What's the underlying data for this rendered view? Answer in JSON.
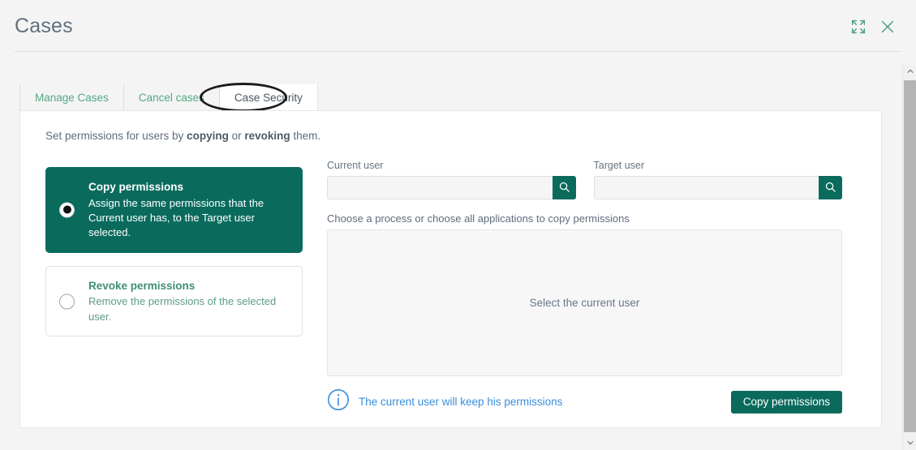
{
  "header": {
    "title": "Cases",
    "expand_icon": "expand-icon",
    "close_icon": "close-icon"
  },
  "tabs": [
    {
      "label": "Manage Cases",
      "active": false
    },
    {
      "label": "Cancel cases",
      "active": false
    },
    {
      "label": "Case Security",
      "active": true
    }
  ],
  "panel": {
    "intro_prefix": "Set permissions for users by ",
    "intro_bold1": "copying",
    "intro_middle": " or ",
    "intro_bold2": "revoking",
    "intro_suffix": " them."
  },
  "options": [
    {
      "title": "Copy permissions",
      "description": "Assign the same permissions that the Current user has, to the Target user selected.",
      "selected": true
    },
    {
      "title": "Revoke permissions",
      "description": "Remove the permissions of the selected user.",
      "selected": false
    }
  ],
  "fields": {
    "current_user": {
      "label": "Current user",
      "value": "",
      "placeholder": "",
      "search_icon": "search-icon"
    },
    "target_user": {
      "label": "Target user",
      "value": "",
      "placeholder": "",
      "search_icon": "search-icon"
    }
  },
  "process": {
    "label": "Choose a process or choose all applications to copy permissions",
    "empty_text": "Select the current user"
  },
  "footer": {
    "info_icon": "info-icon",
    "info_text": "The current user will keep his permissions",
    "action_label": "Copy permissions"
  },
  "scrollbar": {
    "up_icon": "chevron-up-icon",
    "down_icon": "chevron-down-icon"
  },
  "colors": {
    "teal": "#0a6b5d",
    "tab_inactive_text": "#55a882",
    "info_blue": "#3b8ede",
    "page_bg": "#f4f4f5"
  }
}
